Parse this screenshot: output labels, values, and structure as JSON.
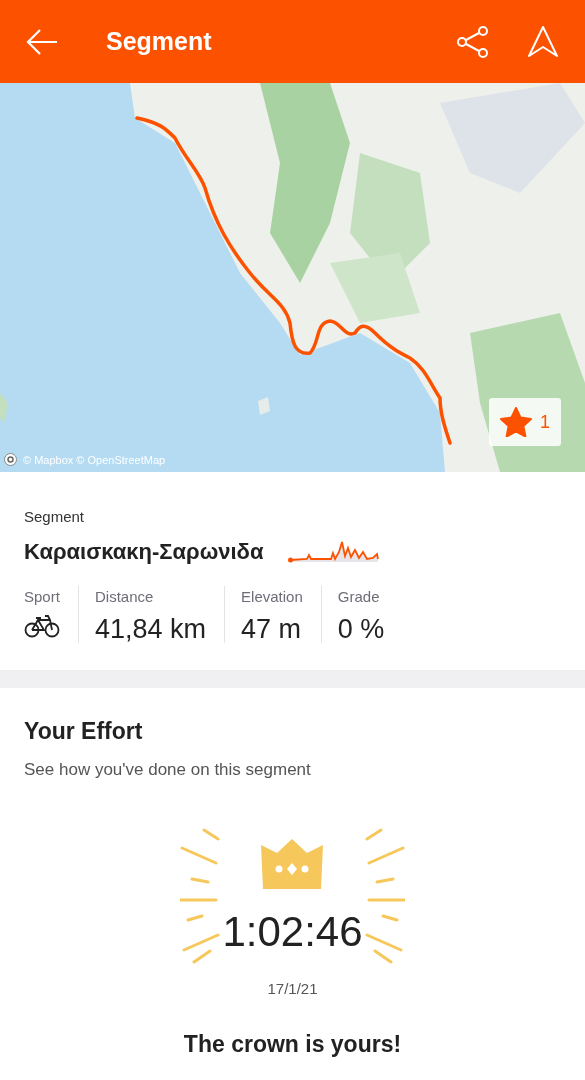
{
  "header": {
    "title": "Segment"
  },
  "map": {
    "star": {
      "starred": true,
      "count": "1"
    },
    "attribution": "© Mapbox © OpenStreetMap"
  },
  "segment": {
    "label": "Segment",
    "name": "Καραισκακη-Σαρωνιδα",
    "stats": [
      {
        "kind": "bike",
        "label": "Sport"
      },
      {
        "kind": "text",
        "label": "Distance",
        "value": "41,84 km"
      },
      {
        "kind": "text",
        "label": "Elevation",
        "value": "47 m"
      },
      {
        "kind": "text",
        "label": "Grade",
        "value": "0 %"
      }
    ]
  },
  "effort": {
    "title": "Your Effort",
    "subtitle": "See how you've done on this segment",
    "time": "1:02:46",
    "date": "17/1/21",
    "message": "The crown is yours!"
  }
}
